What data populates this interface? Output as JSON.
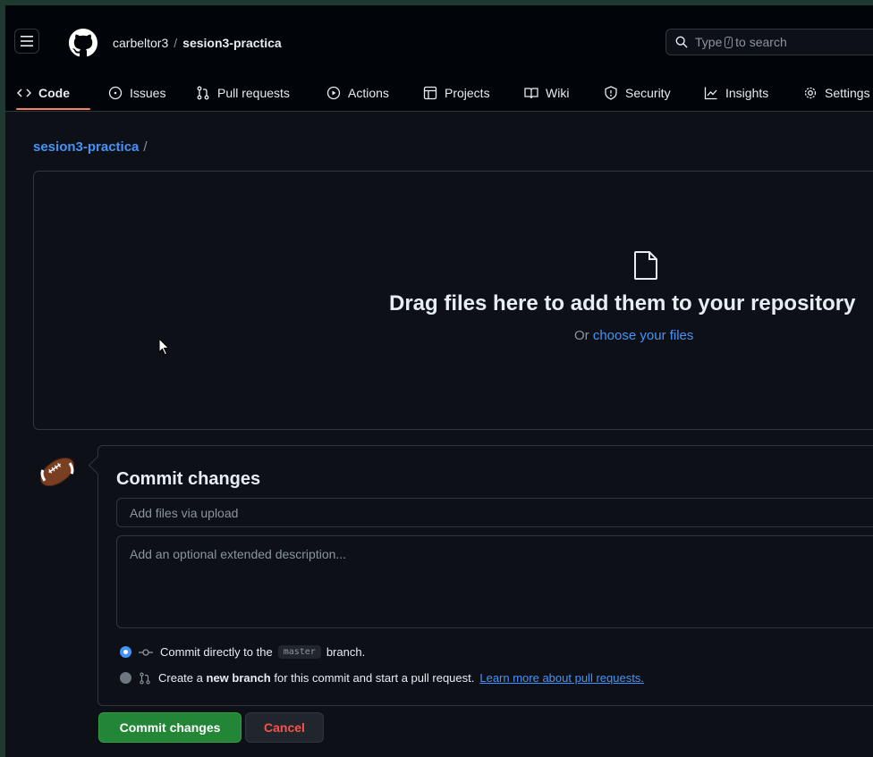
{
  "header": {
    "owner": "carbeltor3",
    "separator": "/",
    "repo": "sesion3-practica",
    "search": {
      "prefix": "Type",
      "key": "/",
      "suffix": "to search"
    }
  },
  "tabs": [
    {
      "label": "Code",
      "icon": "code-icon",
      "active": true
    },
    {
      "label": "Issues",
      "icon": "issue-icon"
    },
    {
      "label": "Pull requests",
      "icon": "pull-request-icon"
    },
    {
      "label": "Actions",
      "icon": "play-icon"
    },
    {
      "label": "Projects",
      "icon": "table-icon"
    },
    {
      "label": "Wiki",
      "icon": "book-icon"
    },
    {
      "label": "Security",
      "icon": "shield-icon"
    },
    {
      "label": "Insights",
      "icon": "graph-icon"
    },
    {
      "label": "Settings",
      "icon": "gear-icon"
    }
  ],
  "breadcrumb": {
    "repo": "sesion3-practica",
    "separator": "/"
  },
  "dropzone": {
    "title": "Drag files here to add them to your repository",
    "sub_prefix": "Or",
    "sub_link": "choose your files"
  },
  "commit": {
    "title": "Commit changes",
    "summary_placeholder": "Add files via upload",
    "description_placeholder": "Add an optional extended description...",
    "option_direct": {
      "prefix": "Commit directly to the",
      "branch": "master",
      "suffix": "branch.",
      "selected": true
    },
    "option_new": {
      "prefix": "Create a",
      "bold": "new branch",
      "suffix": "for this commit and start a pull request.",
      "link": "Learn more about pull requests.",
      "selected": false
    },
    "submit_label": "Commit changes",
    "cancel_label": "Cancel"
  },
  "colors": {
    "background": "#0d1117",
    "header": "#010409",
    "border": "#30363d",
    "link": "#4493f8",
    "primary_button": "#238636",
    "danger_text": "#f85149",
    "tab_underline": "#f78166"
  }
}
